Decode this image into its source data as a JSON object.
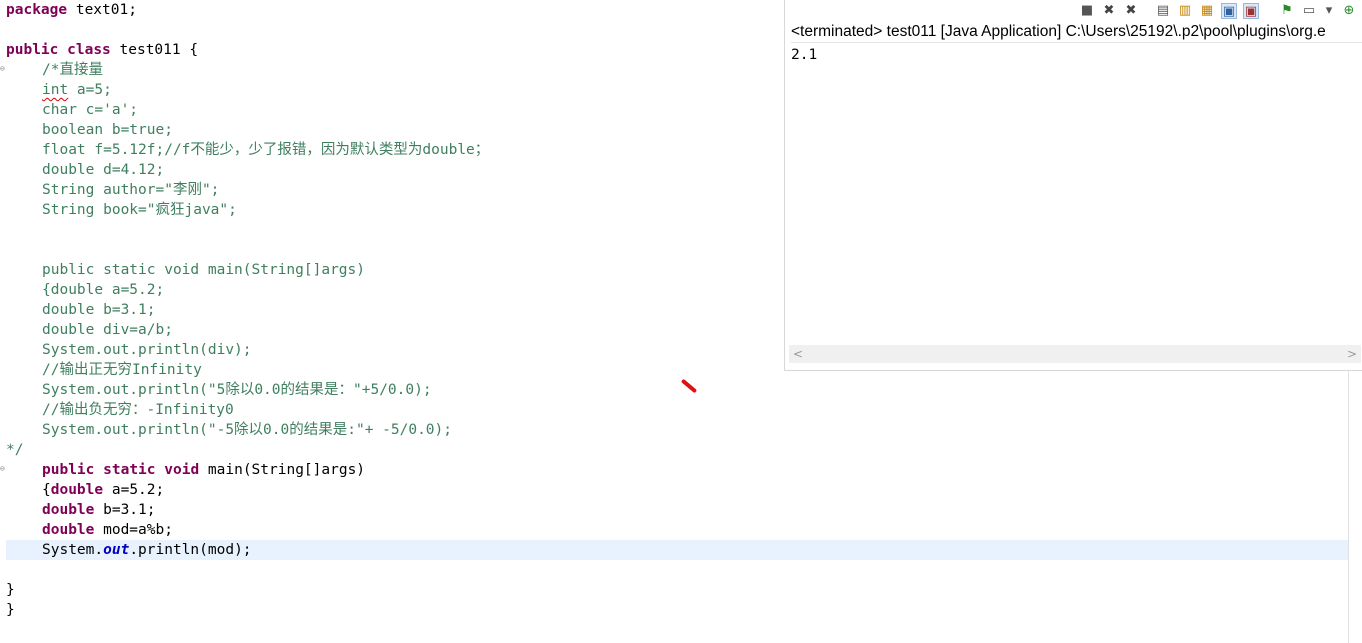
{
  "editor": {
    "lines": [
      {
        "t": "package text01;"
      },
      {
        "t": ""
      },
      {
        "t": "public class test011 {"
      },
      {
        "t": "/*直接量"
      },
      {
        "t": "int a=5;"
      },
      {
        "t": "char c='a';"
      },
      {
        "t": "boolean b=true;"
      },
      {
        "t": "float f=5.12f;//f不能少，少了报错，因为默认类型为double；"
      },
      {
        "t": "double d=4.12;"
      },
      {
        "t": "String author=\"李刚\";"
      },
      {
        "t": "String book=\"疯狂java\";"
      },
      {
        "t": ""
      },
      {
        "t": ""
      },
      {
        "t": "public static void main(String[]args)"
      },
      {
        "t": "{double a=5.2;"
      },
      {
        "t": "double b=3.1;"
      },
      {
        "t": "double div=a/b;"
      },
      {
        "t": "System.out.println(div);"
      },
      {
        "t": "//输出正无穷Infinity"
      },
      {
        "t": "System.out.println(\"5除以0.0的结果是：\"+5/0.0);"
      },
      {
        "t": "//输出负无穷：-Infinity0"
      },
      {
        "t": "System.out.println(\"-5除以0.0的结果是:\"+ -5/0.0);"
      },
      {
        "t": "*/"
      },
      {
        "t": "public static void main(String[]args)"
      },
      {
        "t": "{double a=5.2;"
      },
      {
        "t": "double b=3.1;"
      },
      {
        "t": "double mod=a%b;"
      },
      {
        "t": "System.out.println(mod);"
      },
      {
        "t": ""
      },
      {
        "t": "}"
      },
      {
        "t": "}"
      }
    ],
    "tokens": {
      "kw_package": "package",
      "pkg_name": " text01;",
      "kw_public": "public",
      "kw_class": "class",
      "class_name": " test011 {",
      "kw_double": "double",
      "main_sig": " main(String[]args)",
      "kw_static": "static",
      "kw_void": "void",
      "brace_open": "{",
      "v_a": " a=5.2;",
      "v_b": " b=3.1;",
      "v_mod": " mod=a%b;",
      "sys": "System.",
      "out": "out",
      "println_mod": ".println(mod);",
      "close": "}"
    }
  },
  "console": {
    "title": "<terminated> test011 [Java Application] C:\\Users\\25192\\.p2\\pool\\plugins\\org.e",
    "output": "2.1",
    "toolbar": [
      {
        "icon": "terminate-icon",
        "glyph": "■"
      },
      {
        "icon": "remove-launch-icon",
        "glyph": "✖"
      },
      {
        "icon": "remove-all-terminated-icon",
        "glyph": "✖"
      },
      {
        "icon": "clear-console-icon",
        "glyph": "▤"
      },
      {
        "icon": "scroll-lock-icon",
        "glyph": "▥"
      },
      {
        "icon": "word-wrap-icon",
        "glyph": "▦"
      },
      {
        "icon": "show-on-stdout-icon",
        "glyph": "▣"
      },
      {
        "icon": "show-on-stderr-icon",
        "glyph": "▣"
      },
      {
        "icon": "pin-console-icon",
        "glyph": "⚑"
      },
      {
        "icon": "display-console-icon",
        "glyph": "▭"
      },
      {
        "icon": "console-menu-icon",
        "glyph": "▾"
      },
      {
        "icon": "open-console-icon",
        "glyph": "⊕"
      }
    ]
  }
}
